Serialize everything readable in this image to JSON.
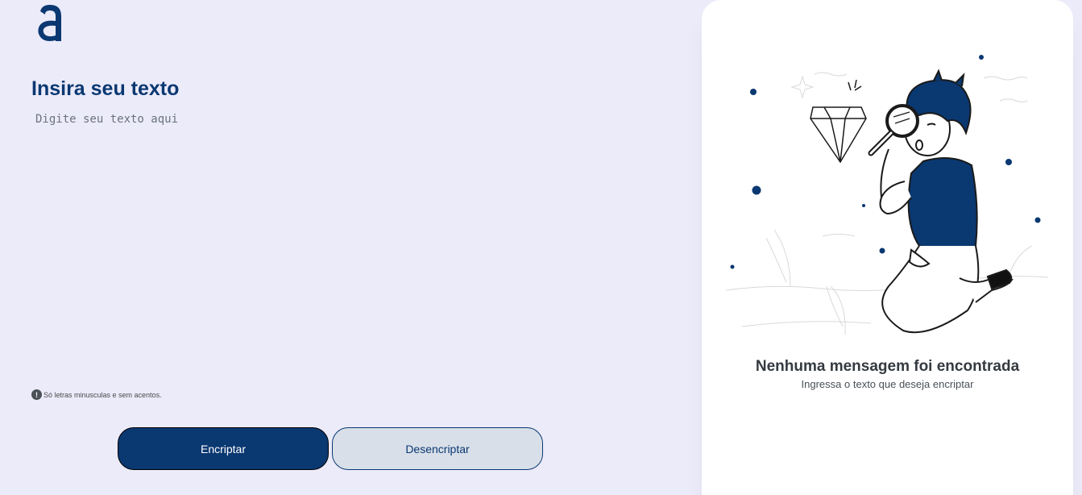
{
  "brand": {
    "logo_icon": "alura-logo-icon",
    "accent_color": "#0a3871"
  },
  "editor": {
    "heading": "Insira seu texto",
    "placeholder": "Digite seu texto aqui",
    "hint_icon": "exclamation-circle-icon",
    "hint_text": "Só letras minusculas e sem acentos."
  },
  "actions": {
    "encrypt_label": "Encriptar",
    "decrypt_label": "Desencriptar"
  },
  "output": {
    "illustration": "person-with-magnifier-diamond-illustration",
    "title": "Nenhuma mensagem foi encontrada",
    "subtitle": "Ingressa o texto que deseja encriptar"
  }
}
